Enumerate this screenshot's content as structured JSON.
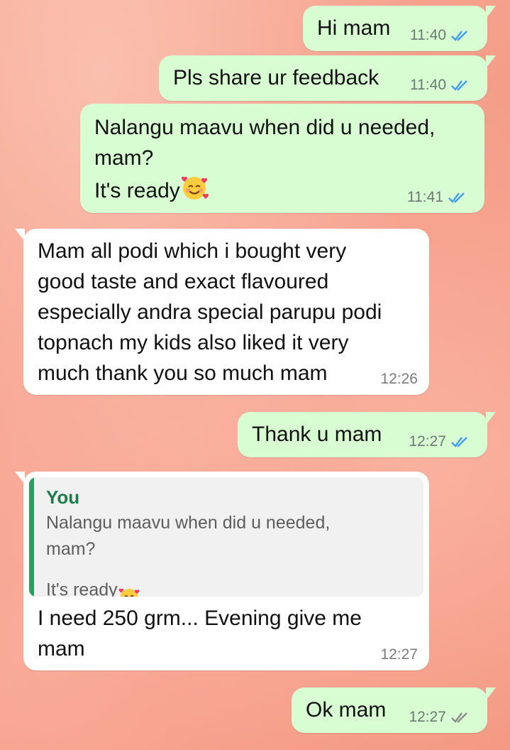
{
  "messages": [
    {
      "id": "m1",
      "direction": "outgoing",
      "text": "Hi mam",
      "time": "11:40",
      "status": "read"
    },
    {
      "id": "m2",
      "direction": "outgoing",
      "text": "Pls share ur feedback",
      "time": "11:40",
      "status": "read"
    },
    {
      "id": "m3",
      "direction": "outgoing",
      "text_lines": [
        "Nalangu maavu when did u needed,",
        "mam?",
        "It's ready"
      ],
      "emoji": "smiling-face-with-hearts",
      "time": "11:41",
      "status": "read"
    },
    {
      "id": "m4",
      "direction": "incoming",
      "text": "Mam all podi which i bought very\ngood taste and exact flavoured\nespecially andra special parupu podi\ntopnach my kids also liked it very\nmuch thank you so much mam",
      "time": "12:26"
    },
    {
      "id": "m5",
      "direction": "outgoing",
      "text": "Thank u mam",
      "time": "12:27",
      "status": "read"
    },
    {
      "id": "m6",
      "direction": "incoming",
      "quoted": {
        "author": "You",
        "text": "Nalangu maavu when did u needed,\nmam?\nIt's ready",
        "emoji": "smiling-face-with-hearts"
      },
      "text": "I need 250 grm... Evening give me\nmam",
      "time": "12:27"
    },
    {
      "id": "m7",
      "direction": "outgoing",
      "text": "Ok mam",
      "time": "12:27",
      "status": "delivered"
    }
  ],
  "colors": {
    "outgoing_bubble": "#d8fdd2",
    "incoming_bubble": "#ffffff",
    "read_ticks": "#3f9bf2",
    "delivered_ticks": "#8a8a8a",
    "quote_accent": "#2a9d60"
  }
}
